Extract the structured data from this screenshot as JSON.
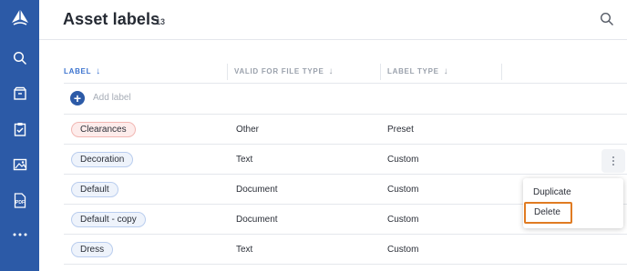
{
  "header": {
    "title": "Asset labels",
    "count": "13"
  },
  "table": {
    "columns": {
      "label": "LABEL",
      "file_type": "VALID FOR FILE TYPE",
      "label_type": "LABEL TYPE",
      "sort_arrow": "↓"
    },
    "add_label": "Add label",
    "rows": [
      {
        "label": "Clearances",
        "file_type": "Other",
        "label_type": "Preset",
        "pill_color": "#fdeceb"
      },
      {
        "label": "Decoration",
        "file_type": "Text",
        "label_type": "Custom",
        "pill_color": "#eef3fb"
      },
      {
        "label": "Default",
        "file_type": "Document",
        "label_type": "Custom",
        "pill_color": "#eef3fb"
      },
      {
        "label": "Default - copy",
        "file_type": "Document",
        "label_type": "Custom",
        "pill_color": "#eef3fb"
      },
      {
        "label": "Dress",
        "file_type": "Text",
        "label_type": "Custom",
        "pill_color": "#eef3fb"
      }
    ]
  },
  "context_menu": {
    "items": [
      "Duplicate",
      "Delete"
    ],
    "highlighted": "Delete"
  },
  "sidebar": {
    "icons": [
      "logo-icon",
      "search-icon",
      "box-icon",
      "clipboard-check-icon",
      "image-icon",
      "pdf-icon",
      "more-icon"
    ],
    "pdf_text": "PDF"
  },
  "colors": {
    "sidebar": "#2c5aa7",
    "accent": "#3b73cf",
    "highlight": "#e07b22"
  }
}
